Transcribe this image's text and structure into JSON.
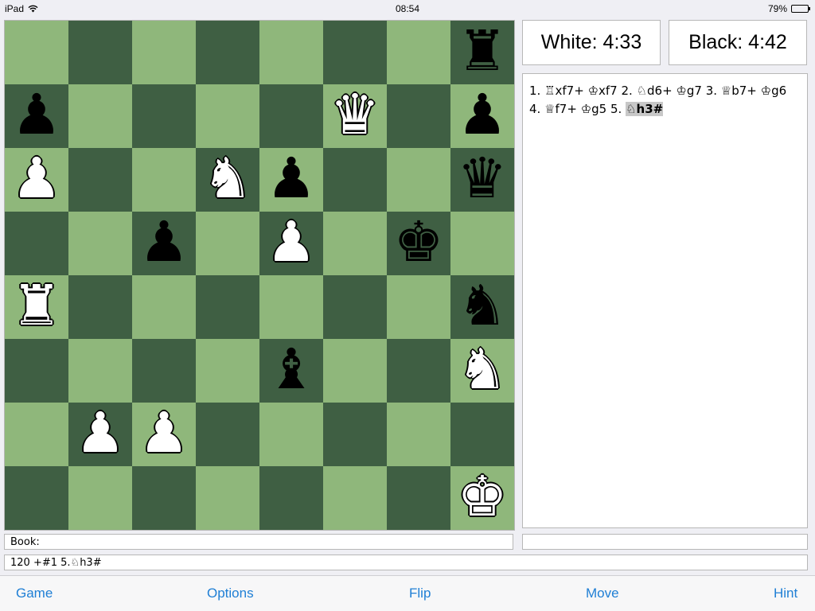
{
  "status_bar": {
    "device": "iPad",
    "time": "08:54",
    "battery": "79%",
    "battery_level": 0.79
  },
  "board": {
    "rows": [
      [
        "",
        "",
        "",
        "",
        "",
        "",
        "",
        "r"
      ],
      [
        "p",
        "",
        "",
        "",
        "",
        "Q",
        "",
        "p"
      ],
      [
        "P",
        "",
        "",
        "N",
        "p",
        "",
        "",
        "q"
      ],
      [
        "",
        "",
        "p",
        "",
        "P",
        "",
        "k",
        ""
      ],
      [
        "R",
        "",
        "",
        "",
        "",
        "",
        "",
        "n"
      ],
      [
        "",
        "",
        "",
        "",
        "b",
        "",
        "",
        "N"
      ],
      [
        "",
        "P",
        "P",
        "",
        "",
        "",
        "",
        ""
      ],
      [
        "",
        "",
        "",
        "",
        "",
        "",
        "",
        "K"
      ]
    ],
    "glyphs": {
      "K": "♚",
      "Q": "♛",
      "R": "♜",
      "B": "♝",
      "N": "♞",
      "P": "♟"
    },
    "colors": {
      "light": "#8fb77b",
      "dark": "#3f5f43"
    }
  },
  "clocks": {
    "white": "White: 4:33",
    "black": "Black: 4:42"
  },
  "moves": {
    "text": "1. ♖xf7+ ♔xf7 2. ♘d6+ ♔g7 3. ♕b7+ ♔g6 4. ♕f7+ ♔g5 5. ",
    "current": "♘h3#"
  },
  "book": "Book:",
  "side_info": "",
  "eval": "120 +#1 5.♘h3#",
  "toolbar": {
    "game": "Game",
    "options": "Options",
    "flip": "Flip",
    "move": "Move",
    "hint": "Hint"
  },
  "accent_color": "#1f7fd5"
}
